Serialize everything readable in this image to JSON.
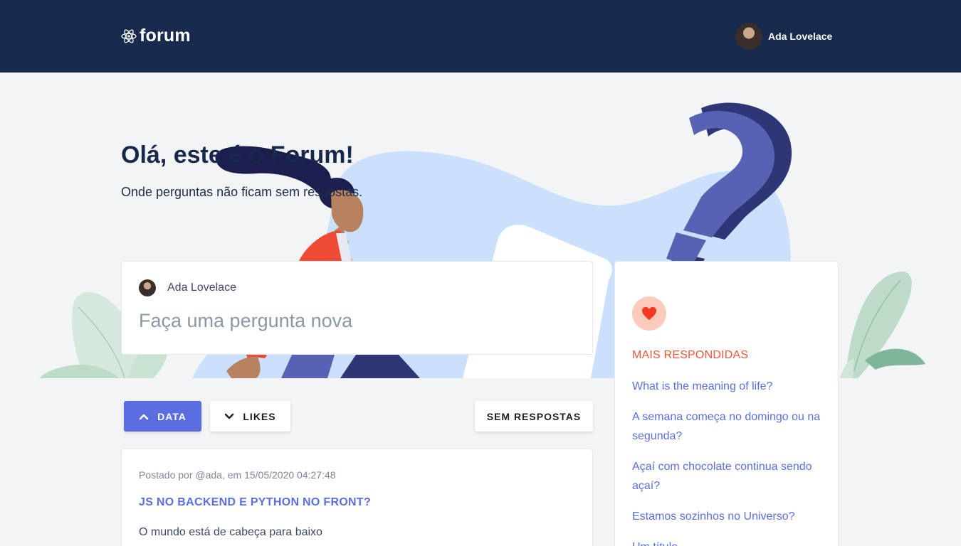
{
  "navbar": {
    "brand": "forum",
    "user_name": "Ada Lovelace"
  },
  "hero": {
    "title": "Olá, este é o Forum!",
    "subtitle": "Onde perguntas não ficam sem respostas."
  },
  "new_question": {
    "user_name": "Ada Lovelace",
    "placeholder": "Faça uma pergunta nova"
  },
  "sort": {
    "data_label": "DATA",
    "likes_label": "LIKES",
    "unanswered_label": "SEM RESPOSTAS"
  },
  "post": {
    "meta": "Postado por @ada, em 15/05/2020 04:27:48",
    "title": "JS NO BACKEND E PYTHON NO FRONT?",
    "body": "O mundo está de cabeça para baixo"
  },
  "sidebar": {
    "title": "MAIS RESPONDIDAS",
    "items": [
      {
        "label": "What is the meaning of life?"
      },
      {
        "label": "A semana começa no domingo ou na segunda?"
      },
      {
        "label": "Açaí com chocolate continua sendo açaí?"
      },
      {
        "label": "Estamos sozinhos no Universo?"
      },
      {
        "label": "Um título"
      }
    ]
  },
  "icons": {
    "brand": "react-atom-icon",
    "sort_asc": "chevron-up-icon",
    "sort_desc": "chevron-down-icon",
    "most_answered": "heart-icon"
  },
  "colors": {
    "navbar": "#182a4e",
    "accent": "#5b6ee1",
    "highlight": "#f0553a",
    "heart_bg": "#fdcbbd"
  }
}
